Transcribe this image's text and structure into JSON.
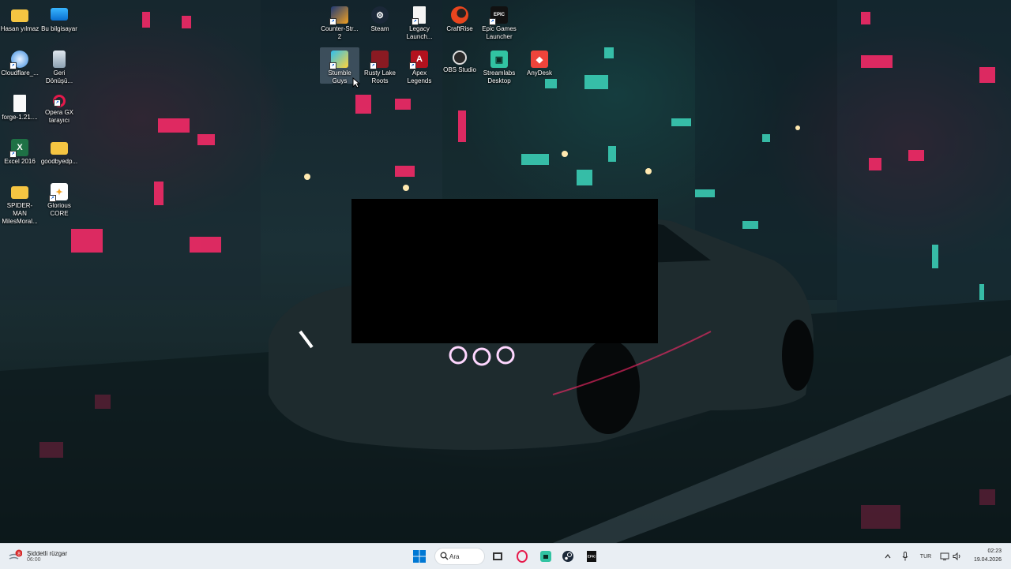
{
  "desktop": {
    "left_icons": [
      {
        "label": "Hasan yılmaz",
        "icon": "folder-icon"
      },
      {
        "label": "Bu bilgisayar",
        "icon": "monitor-icon"
      },
      {
        "label": "Cloudflare_...",
        "icon": "cloudflare-icon"
      },
      {
        "label": "Geri Dönüşü...",
        "icon": "recycle-bin-icon"
      },
      {
        "label": "forge-1.21....",
        "icon": "file-icon"
      },
      {
        "label": "Opera GX tarayıcı",
        "icon": "opera-gx-icon"
      },
      {
        "label": "Excel 2016",
        "icon": "excel-icon"
      },
      {
        "label": "goodbyedp...",
        "icon": "folder-icon"
      },
      {
        "label": "SPIDER-MAN MilesMoral...",
        "icon": "folder-icon"
      },
      {
        "label": "Glorious CORE",
        "icon": "glorious-icon"
      }
    ],
    "top_icons": [
      {
        "label": "Counter-Str... 2",
        "icon": "counter-strike-icon"
      },
      {
        "label": "Steam",
        "icon": "steam-icon"
      },
      {
        "label": "Legacy Launch...",
        "icon": "legacy-launcher-icon"
      },
      {
        "label": "CraftRise",
        "icon": "craftrise-icon"
      },
      {
        "label": "Epic Games Launcher",
        "icon": "epic-games-icon"
      },
      {
        "label": "Stumble Guys",
        "icon": "stumble-guys-icon"
      },
      {
        "label": "Rusty Lake Roots",
        "icon": "rusty-lake-icon"
      },
      {
        "label": "Apex Legends",
        "icon": "apex-legends-icon"
      },
      {
        "label": "OBS Studio",
        "icon": "obs-studio-icon"
      },
      {
        "label": "Streamlabs Desktop",
        "icon": "streamlabs-icon"
      },
      {
        "label": "AnyDesk",
        "icon": "anydesk-icon"
      }
    ]
  },
  "taskbar": {
    "weather": {
      "title": "Şiddetli rüzgar",
      "time": "06:00",
      "badge": "8"
    },
    "search_label": "Ara",
    "tray": {
      "language": "TUR"
    },
    "clock": {
      "time": "02:23",
      "date": "19.04.2026"
    }
  },
  "colors": {
    "taskbar_bg": "#e9eef3",
    "windows_blue": "#0078d4"
  }
}
